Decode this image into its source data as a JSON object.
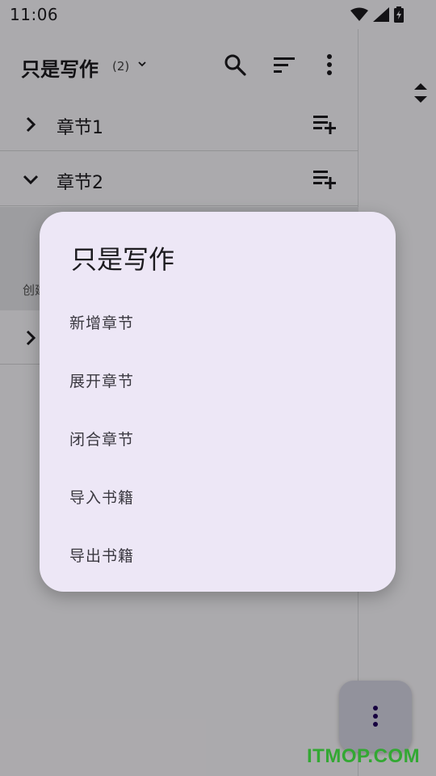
{
  "status_bar": {
    "time": "11:06"
  },
  "top_bar": {
    "title": "只是写作",
    "count": "(2)"
  },
  "chapters": [
    {
      "label": "章节1",
      "expanded": false
    },
    {
      "label": "章节2",
      "expanded": true
    }
  ],
  "sub_item": {
    "label_fragment": "创建"
  },
  "dialog": {
    "title": "只是写作",
    "items": [
      "新增章节",
      "展开章节",
      "闭合章节",
      "导入书籍",
      "导出书籍"
    ]
  },
  "watermark": "ITMOP.COM",
  "icons": {
    "search": "search-icon",
    "sort": "sort-icon",
    "more": "more-vert-icon",
    "add_list": "playlist-add-icon",
    "chevron_right": "chevron-right-icon",
    "chevron_down": "chevron-down-icon"
  },
  "colors": {
    "dialog_bg": "#ede7f6",
    "fab_bg": "#d8d8e6",
    "watermark": "#33a833"
  }
}
